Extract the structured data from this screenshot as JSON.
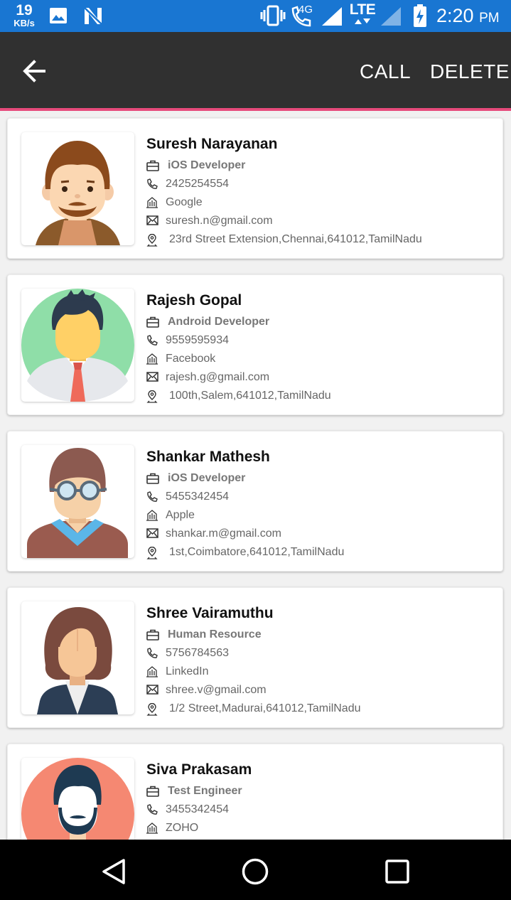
{
  "status_bar": {
    "speed_value": "19",
    "speed_unit": "KB/s",
    "network_4g": "4G",
    "network_lte": "LTE",
    "time": "2:20",
    "ampm": "PM",
    "icons": [
      "gallery-icon",
      "notification-n-icon",
      "vibrate-icon",
      "wifi-call-icon",
      "signal-icon",
      "lte-data-icon",
      "signal-icon",
      "battery-charging-icon"
    ]
  },
  "app_bar": {
    "back_icon": "back-arrow-icon",
    "call_label": "CALL",
    "delete_label": "DELETE",
    "accent_color": "#e64a7b",
    "bar_color": "#303030"
  },
  "contacts": [
    {
      "name": "Suresh Narayanan",
      "role": "iOS Developer",
      "phone": "2425254554",
      "company": "Google",
      "email": "suresh.n@gmail.com",
      "address": "23rd Street Extension,Chennai,641012,TamilNadu"
    },
    {
      "name": "Rajesh Gopal",
      "role": "Android Developer",
      "phone": "9559595934",
      "company": "Facebook",
      "email": "rajesh.g@gmail.com",
      "address": "100th,Salem,641012,TamilNadu"
    },
    {
      "name": "Shankar Mathesh",
      "role": "iOS Developer",
      "phone": "5455342454",
      "company": "Apple",
      "email": "shankar.m@gmail.com",
      "address": "1st,Coimbatore,641012,TamilNadu"
    },
    {
      "name": "Shree Vairamuthu",
      "role": "Human Resource",
      "phone": "5756784563",
      "company": "LinkedIn",
      "email": "shree.v@gmail.com",
      "address": "1/2 Street,Madurai,641012,TamilNadu"
    },
    {
      "name": "Siva Prakasam",
      "role": "Test Engineer",
      "phone": "3455342454",
      "company": "ZOHO",
      "email": "",
      "address": ""
    }
  ],
  "row_icons": [
    "briefcase-icon",
    "phone-icon",
    "building-icon",
    "mail-icon",
    "location-pin-icon"
  ],
  "nav_bar": {
    "buttons": [
      "back-triangle-icon",
      "home-circle-icon",
      "recents-square-icon"
    ]
  }
}
